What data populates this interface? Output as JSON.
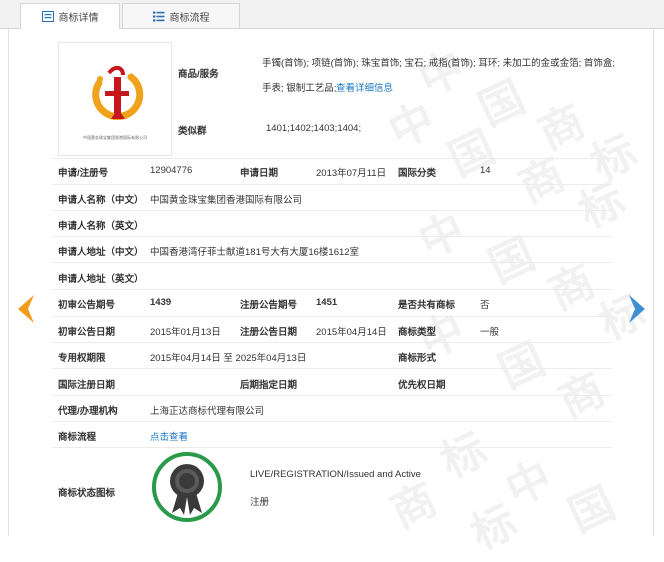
{
  "tabs": [
    {
      "label": "商标详情",
      "icon": "list-icon",
      "active": true
    },
    {
      "label": "商标流程",
      "icon": "list-icon",
      "active": false
    }
  ],
  "watermark": {
    "chars": [
      "中",
      "国",
      "商",
      "标",
      "中",
      "国",
      "商",
      "标",
      "中",
      "国",
      "商",
      "标",
      "中",
      "国",
      "商",
      "标",
      "中",
      "国",
      "商",
      "标"
    ]
  },
  "logo": {
    "caption": "中国黄金珠宝集团香港国际有限公司"
  },
  "goods": {
    "label": "商品/服务",
    "line1": "手镯(首饰); 项链(首饰); 珠宝首饰; 宝石; 戒指(首饰); 耳环; 未加工的金或金箔; 首饰盒;",
    "line2": "手表; 银制工艺品;",
    "link": "查看详细信息"
  },
  "similar_group": {
    "label": "类似群",
    "value": "1401;1402;1403;1404;"
  },
  "rows": {
    "reg_no": {
      "label": "申请/注册号",
      "value": "12904776"
    },
    "app_date": {
      "label": "申请日期",
      "value": "2013年07月11日"
    },
    "intl_class": {
      "label": "国际分类",
      "value": "14"
    },
    "applicant_cn": {
      "label": "申请人名称（中文）",
      "value": "中国黄金珠宝集团香港国际有限公司"
    },
    "applicant_en": {
      "label": "申请人名称（英文）",
      "value": ""
    },
    "address_cn": {
      "label": "申请人地址（中文）",
      "value": "中国香港湾仔菲士献道181号大有大厦16楼1612室"
    },
    "address_en": {
      "label": "申请人地址（英文）",
      "value": ""
    },
    "prelim_no": {
      "label": "初审公告期号",
      "value": "1439"
    },
    "reg_pub_no": {
      "label": "注册公告期号",
      "value": "1451"
    },
    "shared": {
      "label": "是否共有商标",
      "value": "否"
    },
    "prelim_date": {
      "label": "初审公告日期",
      "value": "2015年01月13日"
    },
    "reg_pub_date": {
      "label": "注册公告日期",
      "value": "2015年04月14日"
    },
    "tm_type": {
      "label": "商标类型",
      "value": "一般"
    },
    "validity": {
      "label": "专用权期限",
      "value": "2015年04月14日 至 2025年04月13日"
    },
    "tm_form": {
      "label": "商标形式",
      "value": ""
    },
    "intl_reg_date": {
      "label": "国际注册日期",
      "value": ""
    },
    "later_date": {
      "label": "后期指定日期",
      "value": ""
    },
    "priority_date": {
      "label": "优先权日期",
      "value": ""
    },
    "agent": {
      "label": "代理/办理机构",
      "value": "上海正达商标代理有限公司"
    },
    "process": {
      "label": "商标流程",
      "link": "点击查看"
    },
    "status": {
      "label": "商标状态图标",
      "en": "LIVE/REGISTRATION/Issued and Active",
      "cn": "注册"
    }
  },
  "colors": {
    "arrow_left": "#f39c1b",
    "arrow_right": "#3f8fd6",
    "link": "#1a75c4",
    "seal_ring": "#2a9a4a"
  },
  "nav": {
    "prev_icon": "chevron-left-icon",
    "next_icon": "chevron-right-icon"
  }
}
